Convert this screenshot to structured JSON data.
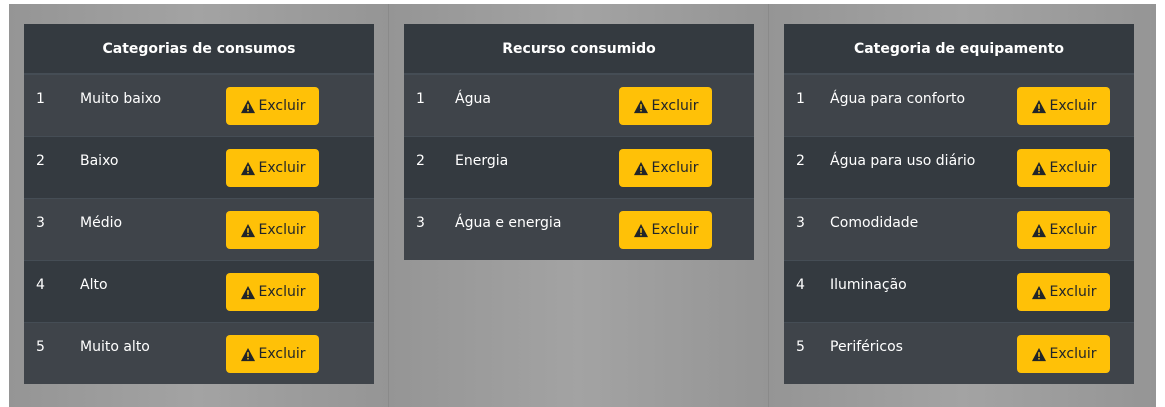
{
  "tables": [
    {
      "title": "Categorias de consumos",
      "rows": [
        {
          "num": "1",
          "name": "Muito baixo",
          "action": "Excluir"
        },
        {
          "num": "2",
          "name": "Baixo",
          "action": "Excluir"
        },
        {
          "num": "3",
          "name": "Médio",
          "action": "Excluir"
        },
        {
          "num": "4",
          "name": "Alto",
          "action": "Excluir"
        },
        {
          "num": "5",
          "name": "Muito alto",
          "action": "Excluir"
        }
      ]
    },
    {
      "title": "Recurso consumido",
      "rows": [
        {
          "num": "1",
          "name": "Água",
          "action": "Excluir"
        },
        {
          "num": "2",
          "name": "Energia",
          "action": "Excluir"
        },
        {
          "num": "3",
          "name": "Água e energia",
          "action": "Excluir"
        }
      ]
    },
    {
      "title": "Categoria de equipamento",
      "rows": [
        {
          "num": "1",
          "name": "Água para conforto",
          "action": "Excluir"
        },
        {
          "num": "2",
          "name": "Água para uso diário",
          "action": "Excluir"
        },
        {
          "num": "3",
          "name": "Comodidade",
          "action": "Excluir"
        },
        {
          "num": "4",
          "name": "Iluminação",
          "action": "Excluir"
        },
        {
          "num": "5",
          "name": "Periféricos",
          "action": "Excluir"
        }
      ]
    }
  ],
  "colors": {
    "button": "#ffc107",
    "panel": "#343a40",
    "row_alt": "#3f444a"
  },
  "icons": {
    "button_icon": "warning-icon"
  }
}
